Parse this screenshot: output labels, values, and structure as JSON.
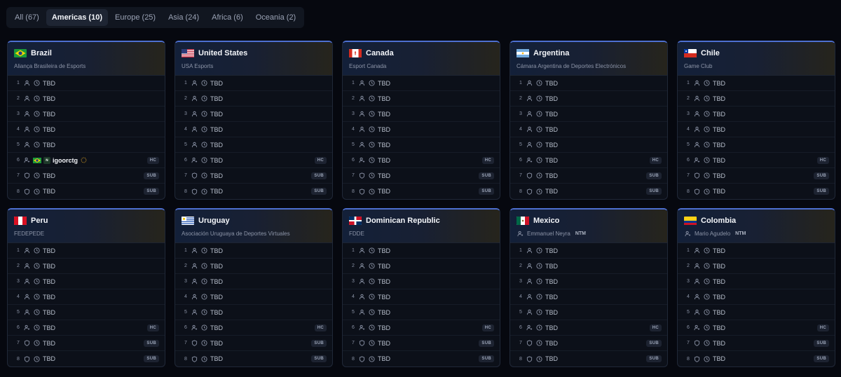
{
  "tabs": [
    {
      "label": "All (67)",
      "active": false
    },
    {
      "label": "Americas (10)",
      "active": true
    },
    {
      "label": "Europe (25)",
      "active": false
    },
    {
      "label": "Asia (24)",
      "active": false
    },
    {
      "label": "Africa (6)",
      "active": false
    },
    {
      "label": "Oceania (2)",
      "active": false
    }
  ],
  "colors": {
    "accent": "#4d6fd0",
    "background": "#06080f",
    "card": "#0c1019"
  },
  "teams": [
    {
      "name": "Brazil",
      "flag": "brazil-flag",
      "subtitle": "Aliança Brasileira de Esports",
      "subtitle_icon": null,
      "ntm": null,
      "slots": [
        {
          "num": "1",
          "player": "TBD"
        },
        {
          "num": "2",
          "player": "TBD"
        },
        {
          "num": "3",
          "player": "TBD"
        },
        {
          "num": "4",
          "player": "TBD"
        },
        {
          "num": "5",
          "player": "TBD"
        },
        {
          "num": "6",
          "player": "igoorctg",
          "badge": "HC",
          "coach": true,
          "confirmed": true
        },
        {
          "num": "7",
          "player": "TBD",
          "badge": "SUB",
          "sub": true
        },
        {
          "num": "8",
          "player": "TBD",
          "badge": "SUB",
          "sub": true
        }
      ]
    },
    {
      "name": "United States",
      "flag": "usa-flag",
      "subtitle": "USA Esports",
      "subtitle_icon": null,
      "ntm": null,
      "slots": [
        {
          "num": "1",
          "player": "TBD"
        },
        {
          "num": "2",
          "player": "TBD"
        },
        {
          "num": "3",
          "player": "TBD"
        },
        {
          "num": "4",
          "player": "TBD"
        },
        {
          "num": "5",
          "player": "TBD"
        },
        {
          "num": "6",
          "player": "TBD",
          "badge": "HC",
          "coach": true
        },
        {
          "num": "7",
          "player": "TBD",
          "badge": "SUB",
          "sub": true
        },
        {
          "num": "8",
          "player": "TBD",
          "badge": "SUB",
          "sub": true
        }
      ]
    },
    {
      "name": "Canada",
      "flag": "canada-flag",
      "subtitle": "Esport Canada",
      "subtitle_icon": null,
      "ntm": null,
      "slots": [
        {
          "num": "1",
          "player": "TBD"
        },
        {
          "num": "2",
          "player": "TBD"
        },
        {
          "num": "3",
          "player": "TBD"
        },
        {
          "num": "4",
          "player": "TBD"
        },
        {
          "num": "5",
          "player": "TBD"
        },
        {
          "num": "6",
          "player": "TBD",
          "badge": "HC",
          "coach": true
        },
        {
          "num": "7",
          "player": "TBD",
          "badge": "SUB",
          "sub": true
        },
        {
          "num": "8",
          "player": "TBD",
          "badge": "SUB",
          "sub": true
        }
      ]
    },
    {
      "name": "Argentina",
      "flag": "argentina-flag",
      "subtitle": "Cámara Argentina de Deportes Electrónicos",
      "subtitle_icon": null,
      "ntm": null,
      "slots": [
        {
          "num": "1",
          "player": "TBD"
        },
        {
          "num": "2",
          "player": "TBD"
        },
        {
          "num": "3",
          "player": "TBD"
        },
        {
          "num": "4",
          "player": "TBD"
        },
        {
          "num": "5",
          "player": "TBD"
        },
        {
          "num": "6",
          "player": "TBD",
          "badge": "HC",
          "coach": true
        },
        {
          "num": "7",
          "player": "TBD",
          "badge": "SUB",
          "sub": true
        },
        {
          "num": "8",
          "player": "TBD",
          "badge": "SUB",
          "sub": true
        }
      ]
    },
    {
      "name": "Chile",
      "flag": "chile-flag",
      "subtitle": "Game Club",
      "subtitle_icon": null,
      "ntm": null,
      "slots": [
        {
          "num": "1",
          "player": "TBD"
        },
        {
          "num": "2",
          "player": "TBD"
        },
        {
          "num": "3",
          "player": "TBD"
        },
        {
          "num": "4",
          "player": "TBD"
        },
        {
          "num": "5",
          "player": "TBD"
        },
        {
          "num": "6",
          "player": "TBD",
          "badge": "HC",
          "coach": true
        },
        {
          "num": "7",
          "player": "TBD",
          "badge": "SUB",
          "sub": true
        },
        {
          "num": "8",
          "player": "TBD",
          "badge": "SUB",
          "sub": true
        }
      ]
    },
    {
      "name": "Peru",
      "flag": "peru-flag",
      "subtitle": "FEDEPEDE",
      "subtitle_icon": null,
      "ntm": null,
      "slots": [
        {
          "num": "1",
          "player": "TBD"
        },
        {
          "num": "2",
          "player": "TBD"
        },
        {
          "num": "3",
          "player": "TBD"
        },
        {
          "num": "4",
          "player": "TBD"
        },
        {
          "num": "5",
          "player": "TBD"
        },
        {
          "num": "6",
          "player": "TBD",
          "badge": "HC",
          "coach": true
        },
        {
          "num": "7",
          "player": "TBD",
          "badge": "SUB",
          "sub": true
        },
        {
          "num": "8",
          "player": "TBD",
          "badge": "SUB",
          "sub": true
        }
      ]
    },
    {
      "name": "Uruguay",
      "flag": "uruguay-flag",
      "subtitle": "Asociación Uruguaya de Deportes Virtuales",
      "subtitle_icon": null,
      "ntm": null,
      "slots": [
        {
          "num": "1",
          "player": "TBD"
        },
        {
          "num": "2",
          "player": "TBD"
        },
        {
          "num": "3",
          "player": "TBD"
        },
        {
          "num": "4",
          "player": "TBD"
        },
        {
          "num": "5",
          "player": "TBD"
        },
        {
          "num": "6",
          "player": "TBD",
          "badge": "HC",
          "coach": true
        },
        {
          "num": "7",
          "player": "TBD",
          "badge": "SUB",
          "sub": true
        },
        {
          "num": "8",
          "player": "TBD",
          "badge": "SUB",
          "sub": true
        }
      ]
    },
    {
      "name": "Dominican Republic",
      "flag": "dominican-republic-flag",
      "subtitle": "FDDE",
      "subtitle_icon": null,
      "ntm": null,
      "slots": [
        {
          "num": "1",
          "player": "TBD"
        },
        {
          "num": "2",
          "player": "TBD"
        },
        {
          "num": "3",
          "player": "TBD"
        },
        {
          "num": "4",
          "player": "TBD"
        },
        {
          "num": "5",
          "player": "TBD"
        },
        {
          "num": "6",
          "player": "TBD",
          "badge": "HC",
          "coach": true
        },
        {
          "num": "7",
          "player": "TBD",
          "badge": "SUB",
          "sub": true
        },
        {
          "num": "8",
          "player": "TBD",
          "badge": "SUB",
          "sub": true
        }
      ]
    },
    {
      "name": "Mexico",
      "flag": "mexico-flag",
      "subtitle": "Emmanuel Neyra",
      "subtitle_icon": "manager-icon",
      "ntm": "NTM",
      "slots": [
        {
          "num": "1",
          "player": "TBD"
        },
        {
          "num": "2",
          "player": "TBD"
        },
        {
          "num": "3",
          "player": "TBD"
        },
        {
          "num": "4",
          "player": "TBD"
        },
        {
          "num": "5",
          "player": "TBD"
        },
        {
          "num": "6",
          "player": "TBD",
          "badge": "HC",
          "coach": true
        },
        {
          "num": "7",
          "player": "TBD",
          "badge": "SUB",
          "sub": true
        },
        {
          "num": "8",
          "player": "TBD",
          "badge": "SUB",
          "sub": true
        }
      ]
    },
    {
      "name": "Colombia",
      "flag": "colombia-flag",
      "subtitle": "Mario Agudelo",
      "subtitle_icon": "manager-icon",
      "ntm": "NTM",
      "slots": [
        {
          "num": "1",
          "player": "TBD"
        },
        {
          "num": "2",
          "player": "TBD"
        },
        {
          "num": "3",
          "player": "TBD"
        },
        {
          "num": "4",
          "player": "TBD"
        },
        {
          "num": "5",
          "player": "TBD"
        },
        {
          "num": "6",
          "player": "TBD",
          "badge": "HC",
          "coach": true
        },
        {
          "num": "7",
          "player": "TBD",
          "badge": "SUB",
          "sub": true
        },
        {
          "num": "8",
          "player": "TBD",
          "badge": "SUB",
          "sub": true
        }
      ]
    }
  ]
}
